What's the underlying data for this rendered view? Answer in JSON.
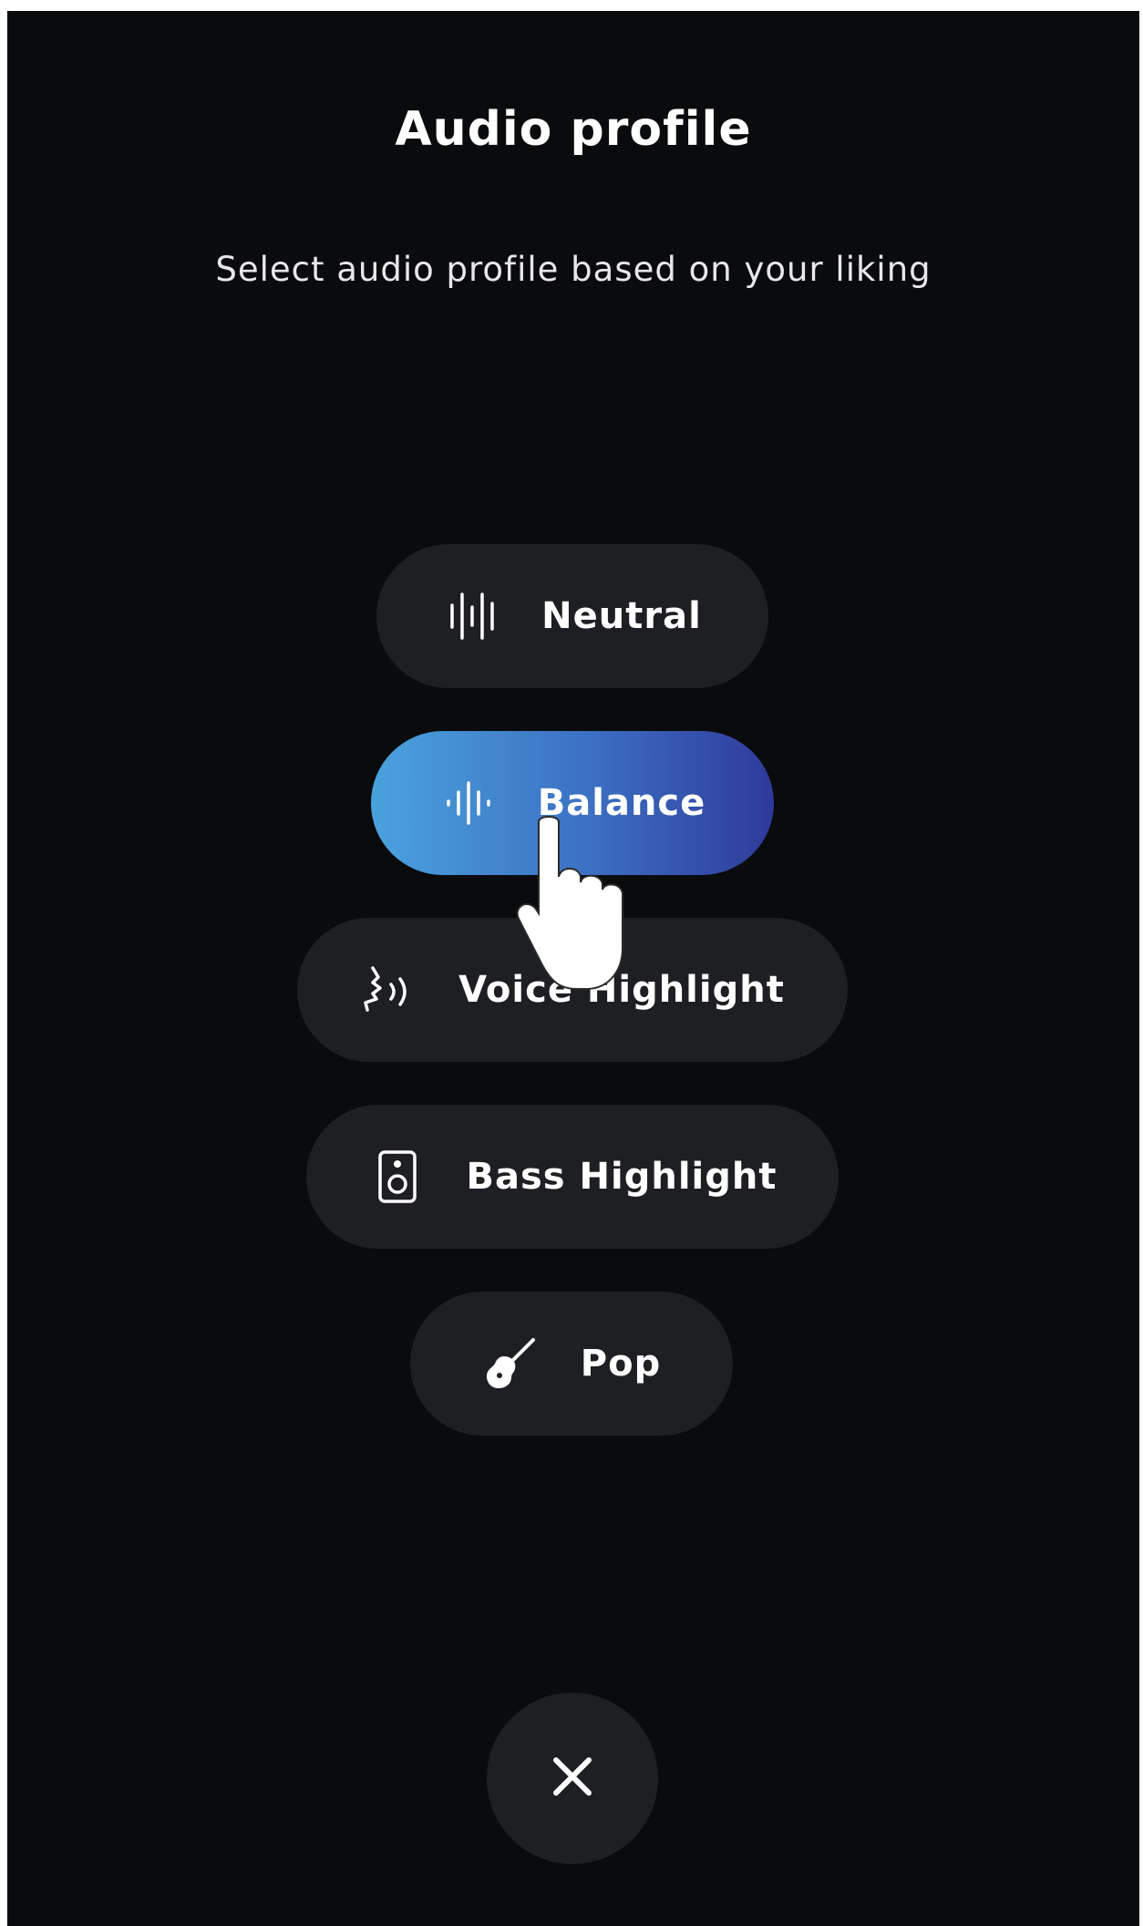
{
  "header": {
    "title": "Audio profile",
    "subtitle": "Select audio profile based on your liking"
  },
  "options": [
    {
      "label": "Neutral",
      "icon": "waveform-icon",
      "selected": false
    },
    {
      "label": "Balance",
      "icon": "waveform-small-icon",
      "selected": true
    },
    {
      "label": "Voice Highlight",
      "icon": "voice-icon",
      "selected": false
    },
    {
      "label": "Bass Highlight",
      "icon": "speaker-icon",
      "selected": false
    },
    {
      "label": "Pop",
      "icon": "guitar-icon",
      "selected": false
    }
  ],
  "colors": {
    "background": "#0a0b0d",
    "option_background": "#1e1f22",
    "selected_gradient_start": "#4aa3dd",
    "selected_gradient_end": "#2f3a9a",
    "text": "#ffffff"
  },
  "pointer": {
    "icon": "hand-pointer-icon"
  },
  "close": {
    "icon": "close-icon"
  }
}
